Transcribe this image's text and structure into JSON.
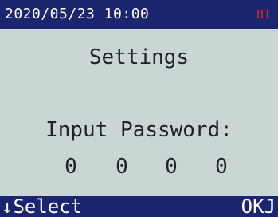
{
  "status_bar": {
    "datetime": "2020/05/23 10:00",
    "bluetooth_label": "BT",
    "bluetooth_color": "#e2232b"
  },
  "screen": {
    "title": "Settings",
    "prompt": "Input Password:",
    "password_digits": [
      "0",
      "0",
      "0",
      "0"
    ]
  },
  "softkeys": {
    "left_label": "↓Select",
    "right_label": "OKJ"
  },
  "colors": {
    "bar_background": "#1c2570",
    "screen_background": "#c9d6d4",
    "text": "#202327"
  }
}
